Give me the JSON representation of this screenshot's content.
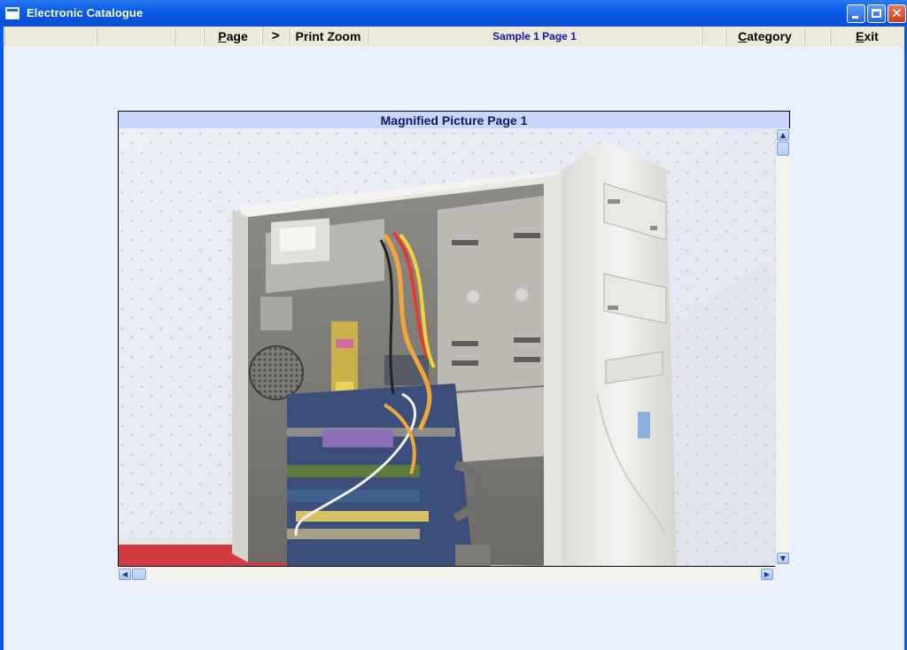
{
  "window": {
    "title": "Electronic Catalogue",
    "controls": [
      "minimize-icon",
      "maximize-icon",
      "close-icon"
    ]
  },
  "menubar": {
    "page": "Page",
    "page_mnemonic": "P",
    "next": ">",
    "print_zoom": "Print Zoom",
    "status": "Sample 1 Page 1",
    "category": "Category",
    "category_mnemonic": "C",
    "exit": "Exit",
    "exit_mnemonic": "E"
  },
  "viewer": {
    "heading": "Magnified Picture Page 1",
    "image_subject": "computer-tower-interior-photo"
  },
  "colors": {
    "titlebar": "#0b5ce6",
    "menubar": "#ece9d8",
    "status_text": "#1414b4",
    "panel_header": "#c6d7fb",
    "client_bg": "#eaf0fb"
  }
}
